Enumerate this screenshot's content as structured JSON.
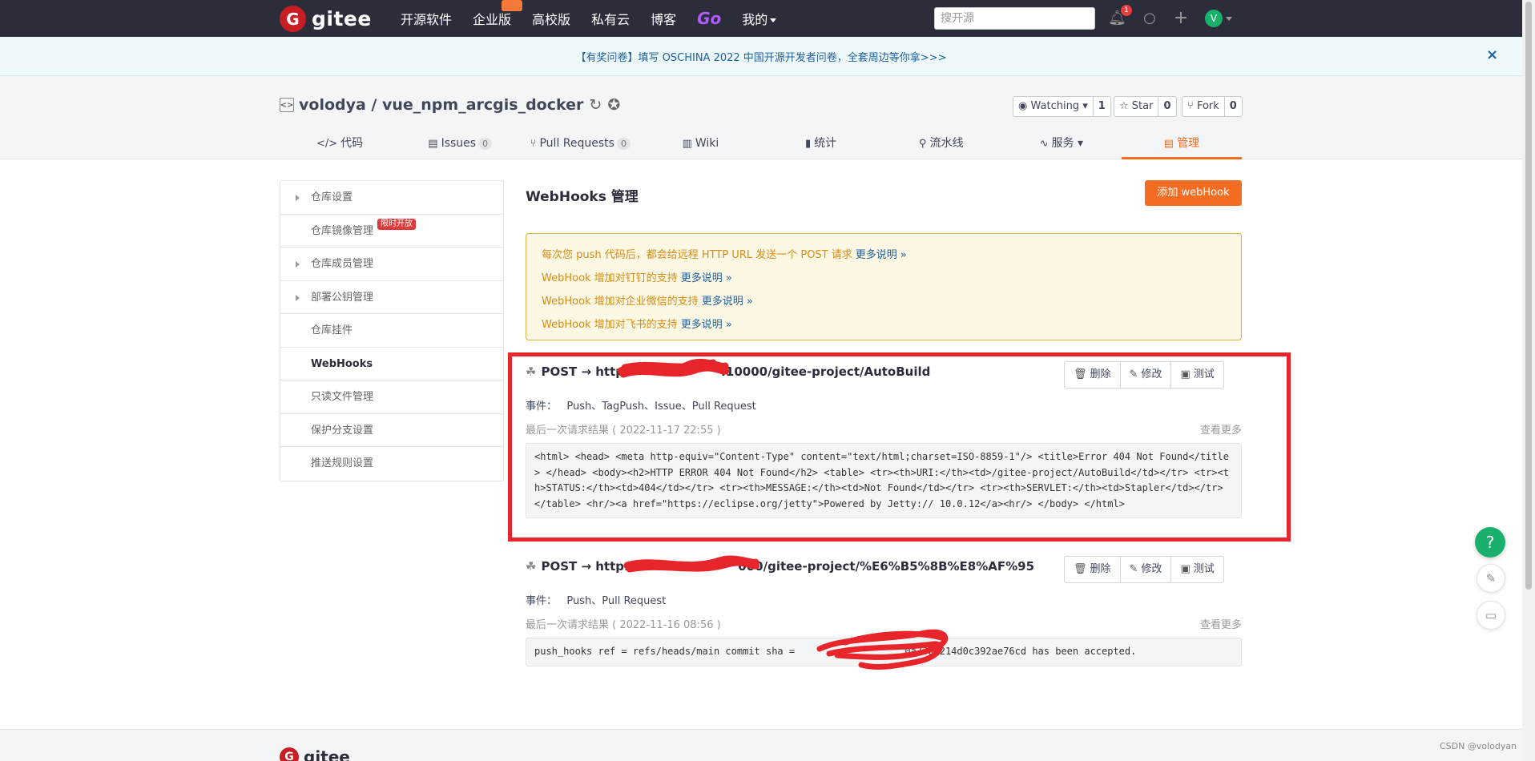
{
  "nav": {
    "logo_letter": "G",
    "logo_text": "gitee",
    "items": [
      "开源软件",
      "企业版",
      "高校版",
      "私有云",
      "博客",
      "Go",
      "我的"
    ],
    "search_placeholder": "搜开源",
    "notification_count": "1",
    "avatar_letter": "V"
  },
  "banner": {
    "text": "【有奖问卷】填写 OSCHINA 2022 中国开源开发者问卷，全套周边等你拿>>>",
    "close": "×"
  },
  "repo": {
    "owner": "volodya",
    "sep": " / ",
    "name": "vue_npm_arcgis_docker",
    "watch_label": "Watching",
    "watch_count": "1",
    "star_label": "Star",
    "star_count": "0",
    "fork_label": "Fork",
    "fork_count": "0"
  },
  "tabs": [
    {
      "label": "代码",
      "icon": "</>"
    },
    {
      "label": "Issues",
      "icon": "▤",
      "count": "0"
    },
    {
      "label": "Pull Requests",
      "icon": "⑂",
      "count": "0"
    },
    {
      "label": "Wiki",
      "icon": "▥"
    },
    {
      "label": "统计",
      "icon": "▮"
    },
    {
      "label": "流水线",
      "icon": "⚲"
    },
    {
      "label": "服务",
      "icon": "∿"
    },
    {
      "label": "管理",
      "icon": "▤"
    }
  ],
  "sidebar": {
    "items": [
      {
        "label": "仓库设置"
      },
      {
        "label": "仓库镜像管理",
        "badge": "限时开放"
      },
      {
        "label": "仓库成员管理"
      },
      {
        "label": "部署公钥管理"
      },
      {
        "label": "仓库挂件"
      },
      {
        "label": "WebHooks"
      },
      {
        "label": "只读文件管理"
      },
      {
        "label": "保护分支设置"
      },
      {
        "label": "推送规则设置"
      }
    ]
  },
  "main": {
    "title": "WebHooks 管理",
    "add_button": "添加 webHook",
    "notice": [
      {
        "text": "每次您 push 代码后，都会给远程 HTTP URL 发送一个 POST 请求",
        "link": "更多说明 »"
      },
      {
        "text": "WebHook 增加对钉钉的支持",
        "link": "更多说明 »"
      },
      {
        "text": "WebHook 增加对企业微信的支持",
        "link": "更多说明 »"
      },
      {
        "text": "WebHook 增加对飞书的支持",
        "link": "更多说明 »"
      }
    ]
  },
  "hooks": [
    {
      "url": "POST → http:                      :10000/gitee-project/AutoBuild",
      "events": "事件：   Push、TagPush、Issue、Pull Request",
      "last_result": "最后一次请求结果 ( 2022-11-17 22:55 )",
      "more": "查看更多",
      "response": "<html> <head> <meta http-equiv=\"Content-Type\" content=\"text/html;charset=ISO-8859-1\"/> <title>Error 404 Not Found</title> </head> <body><h2>HTTP ERROR 404 Not Found</h2> <table> <tr><th>URI:</th><td>/gitee-project/AutoBuild</td></tr> <tr><th>STATUS:</th><td>404</td></tr> <tr><th>MESSAGE:</th><td>Not Found</td></tr> <tr><th>SERVLET:</th><td>Stapler</td></tr> </table> <hr/><a href=\"https://eclipse.org/jetty\">Powered by Jetty:// 10.0.12</a><hr/> </body> </html>"
    },
    {
      "url": "POST → http://                        000/gitee-project/%E6%B5%8B%E8%AF%95",
      "events": "事件：   Push、Pull Request",
      "last_result": "最后一次请求结果 ( 2022-11-16 08:56 )",
      "more": "查看更多",
      "response": "push_hooks ref = refs/heads/main commit sha =                   0a7381214d0c392ae76cd has been accepted."
    }
  ],
  "hook_buttons": {
    "delete": "删除",
    "edit": "修改",
    "test": "测试"
  },
  "floating": {
    "help": "?"
  },
  "footer": {
    "logo_letter": "G",
    "logo_text": "gitee"
  },
  "watermark": "CSDN @volodyan"
}
